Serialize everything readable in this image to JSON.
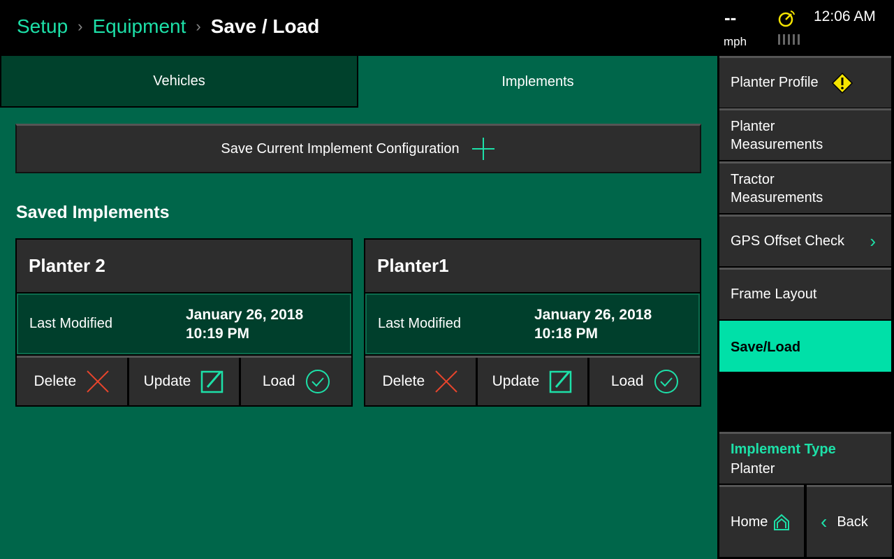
{
  "breadcrumb": {
    "items": [
      "Setup",
      "Equipment"
    ],
    "current": "Save / Load"
  },
  "status": {
    "speed": "--",
    "speed_unit": "mph",
    "time": "12:06 AM",
    "gps_icon": "satellite-dish-icon"
  },
  "tabs": [
    {
      "label": "Vehicles",
      "active": false
    },
    {
      "label": "Implements",
      "active": true
    }
  ],
  "save_button": "Save Current Implement Configuration",
  "section_title": "Saved Implements",
  "cards": [
    {
      "name": "Planter 2",
      "modified_label": "Last Modified",
      "date": "January 26, 2018",
      "time": "10:19 PM",
      "delete": "Delete",
      "update": "Update",
      "load": "Load"
    },
    {
      "name": "Planter1",
      "modified_label": "Last Modified",
      "date": "January 26, 2018",
      "time": "10:18 PM",
      "delete": "Delete",
      "update": "Update",
      "load": "Load"
    }
  ],
  "sidebar": {
    "items": [
      "Planter Profile",
      "Planter Measurements",
      "Tractor Measurements",
      "GPS Offset Check",
      "Frame Layout",
      "Save/Load"
    ],
    "active": "Save/Load",
    "implement_type_label": "Implement Type",
    "implement_type": "Planter",
    "home": "Home",
    "back": "Back"
  },
  "colors": {
    "accent": "#1de0a8",
    "active_bg": "#00e0a8",
    "main_bg": "#00664a",
    "warning": "#f5e400",
    "delete": "#e8452c"
  }
}
